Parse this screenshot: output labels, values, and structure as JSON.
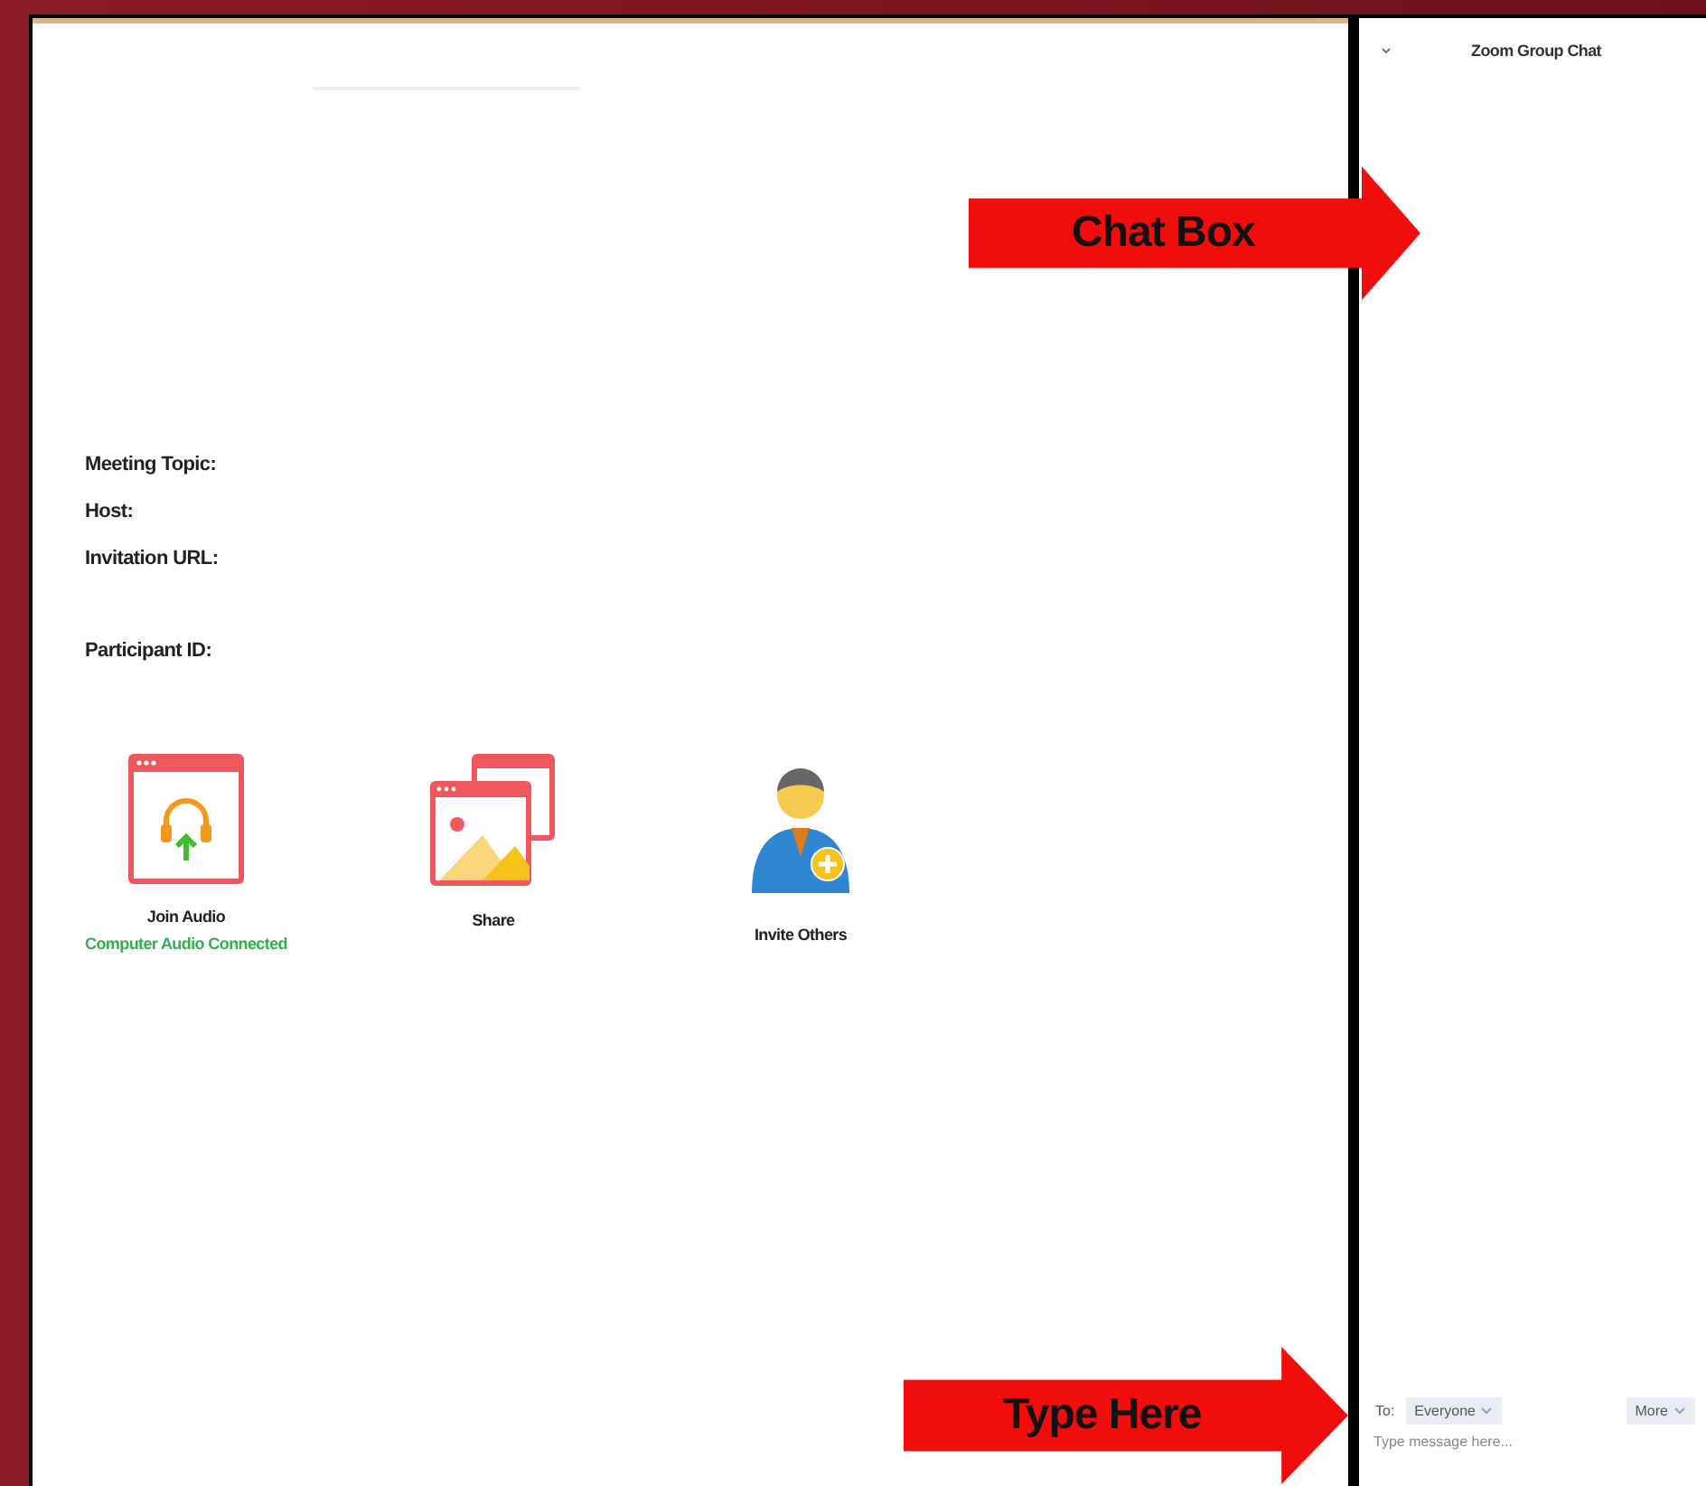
{
  "meeting_info": [
    {
      "labels": [
        "Meeting Topic:",
        "Host:",
        "Invitation URL:"
      ]
    },
    {
      "labels": [
        "Participant ID:"
      ]
    }
  ],
  "actions": [
    {
      "kind": "audio",
      "label": "Join Audio",
      "status": "Computer Audio Connected"
    },
    {
      "kind": "share",
      "label": "Share"
    },
    {
      "kind": "invite",
      "label": "Invite Others"
    }
  ],
  "chat": {
    "title": "Zoom Group Chat",
    "to_label": "To:",
    "recipient": "Everyone",
    "more": "More",
    "placeholder": "Type message here..."
  },
  "annotations": [
    {
      "kind": "top",
      "text": "Chat Box"
    },
    {
      "kind": "bottom",
      "text": "Type Here"
    }
  ]
}
